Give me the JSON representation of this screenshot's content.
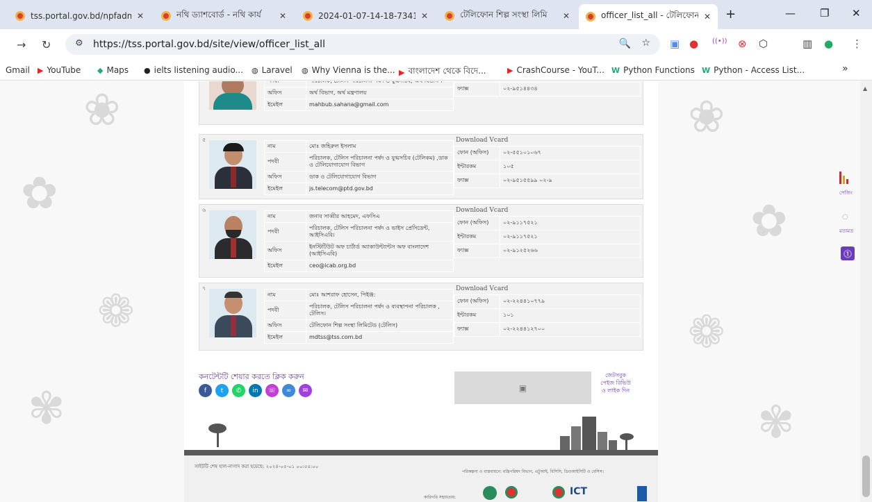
{
  "tabs": [
    {
      "title": "tss.portal.gov.bd/npfadm"
    },
    {
      "title": "নথি ড্যাশবোর্ড - নথি কার্য"
    },
    {
      "title": "2024-01-07-14-18-7341"
    },
    {
      "title": "টেলিফোন শিল্প সংস্থা লিমি"
    },
    {
      "title": "officer_list_all - টেলিফোন"
    }
  ],
  "address": {
    "url": "https://tss.portal.gov.bd/site/view/officer_list_all"
  },
  "bookmarks": [
    {
      "label": "Gmail"
    },
    {
      "label": "YouTube"
    },
    {
      "label": "Maps"
    },
    {
      "label": "ielts listening audio..."
    },
    {
      "label": "Laravel"
    },
    {
      "label": "Why Vienna is the..."
    },
    {
      "label": "বাংলাদেশ থেকে বিদে..."
    },
    {
      "label": "CrashCourse - YouT..."
    },
    {
      "label": "Python Functions"
    },
    {
      "label": "Python - Access List..."
    }
  ],
  "labels": {
    "name": "নাম",
    "designation": "পদবী",
    "office": "অফিস",
    "email": "ইমেইল",
    "phone": "ফোন (অফিস)",
    "intercom": "ইন্টারকম",
    "fax": "ফ্যাক্স",
    "vcard": "Download Vcard"
  },
  "partial": {
    "designation": "পরিচালক, টেলিস পরিচালনা পর্ষদ ও যুগ্মসচিব, অর্থ বিভাগ ।",
    "office": "অর্থ বিভাগ, অর্থ মন্ত্রণালয়",
    "email": "mahbub.sahana@gmail.com",
    "fax": "০২-৯৫১৪৪৩৪"
  },
  "officers": [
    {
      "num": "৫",
      "name": "মোঃ জহিরুল ইসলাম",
      "designation": "পরিচালক, টেলিস পরিচালনা পর্ষদ ও যুগ্মসচিব (টেলিকম) ,ডাক ও টেলিযোগাযোগ বিভাগ",
      "office": "ডাক ও টেলিযোগাযোগ বিভাগ",
      "email": "js.telecom@ptd.gov.bd",
      "phone": "০২-৫৫১০১০৬৭",
      "intercom": "১০৫",
      "fax": "০২-৯৫১৫৫৯৯ ০২-৯"
    },
    {
      "num": "৬",
      "name": "জনাব সাব্বীর আহমেদ, এফসিএ",
      "designation": "পরিচালক, টেলিস পরিচালনা পর্ষদ ও ভাইস প্রেসিডেন্ট, আইসিএবি।",
      "office": "ইনস্টিটিউট অফ চার্টার্ড অ্যাকাউন্ট্যান্টস অফ বাংলাদেশ (আইসিএবি)",
      "email": "ceo@icab.org.bd",
      "phone": "০২-৯১১৭৫২১",
      "intercom": "০২-৯১১৭৫২১",
      "fax": "০২-৯১২৫২৬৬"
    },
    {
      "num": "৭",
      "name": "মোঃ আশরাফ হোসেন, পিইঞ্জ:",
      "designation": "পরিচালক, টেলিস পরিচালনা পর্ষদ ও ব্যবস্থাপনা পরিচালক , টেলিস।",
      "office": "টেলিফোন শিল্প সংস্থা লিমিটেড (টেলিস)",
      "email": "mdtss@tss.com.bd",
      "phone": "০২-২২৪৪১০৭৭৯",
      "intercom": "১০১",
      "fax": "০২-২২৪৪১২৭০০"
    }
  ],
  "share": {
    "label": "কনটেন্টটি শেয়ার করতে ক্লিক করুন"
  },
  "rate_box": "জেটসবুক পেইজ রিভিউ ও লাইক দিন",
  "footer": {
    "updated": "সাইটটি শেষ হাল-নাগাদ করা হয়েছে: ২০২৪-০৫-০১ ০০:৫৫:০০",
    "partners": "পরিকল্পনা ও বাস্তবায়নে: মন্ত্রিপরিষদ বিভাগ, এটুআই, বিসিসি, ডিওআইসিটি ও বেসিস।",
    "tech": "কারিগরি সহায়তায়:"
  },
  "side": {
    "item1": "পেজিং",
    "item2": "মতামত"
  }
}
